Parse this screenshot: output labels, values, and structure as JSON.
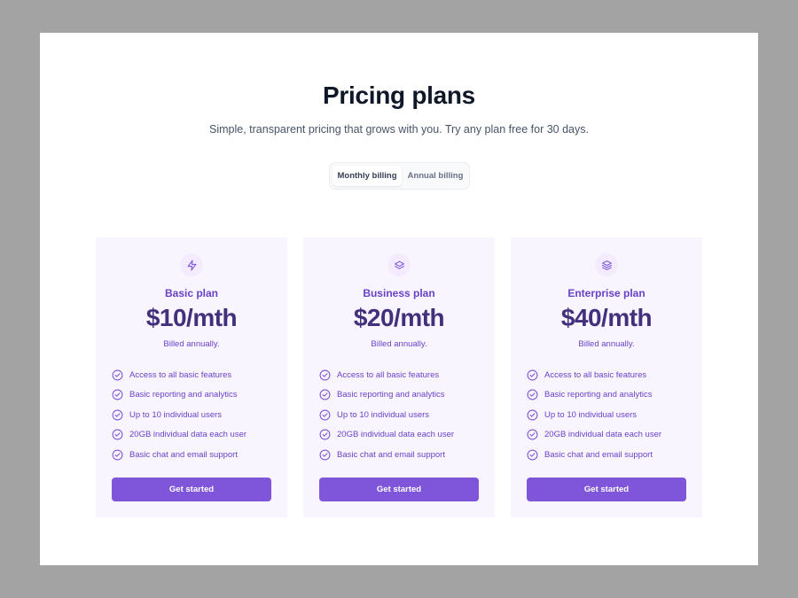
{
  "header": {
    "title": "Pricing plans",
    "subtitle": "Simple, transparent pricing that grows with you. Try any plan free for 30 days."
  },
  "billing_toggle": {
    "options": [
      {
        "label": "Monthly billing",
        "selected": true
      },
      {
        "label": "Annual billing",
        "selected": false
      }
    ]
  },
  "colors": {
    "accent": "#7f56d9",
    "card_background": "#f9f5ff",
    "plan_name": "#6941c6",
    "price": "#42307d"
  },
  "plans": [
    {
      "icon": "lightning-bolt-icon",
      "name": "Basic plan",
      "price": "$10/mth",
      "billed": "Billed annually.",
      "features": [
        "Access to all basic features",
        "Basic reporting and analytics",
        "Up to 10 individual users",
        "20GB individual data each user",
        "Basic chat and email support"
      ],
      "cta": "Get started"
    },
    {
      "icon": "layers-two-icon",
      "name": "Business plan",
      "price": "$20/mth",
      "billed": "Billed annually.",
      "features": [
        "Access to all basic features",
        "Basic reporting and analytics",
        "Up to 10 individual users",
        "20GB individual data each user",
        "Basic chat and email support"
      ],
      "cta": "Get started"
    },
    {
      "icon": "layers-three-icon",
      "name": "Enterprise plan",
      "price": "$40/mth",
      "billed": "Billed annually.",
      "features": [
        "Access to all basic features",
        "Basic reporting and analytics",
        "Up to 10 individual users",
        "20GB individual data each user",
        "Basic chat and email support"
      ],
      "cta": "Get started"
    }
  ]
}
